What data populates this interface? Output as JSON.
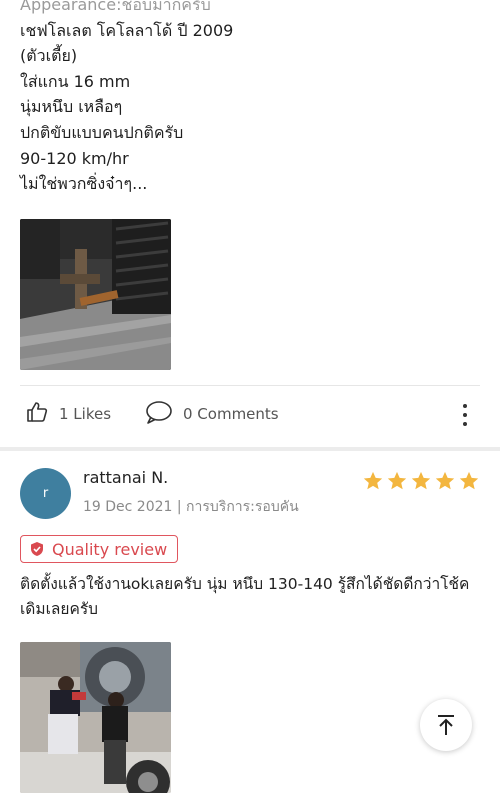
{
  "previous_review": {
    "text_lines": [
      "Appearance:ชอบมากครับ",
      "เชฟโลเลต โคโลลาโด้ ปี 2009",
      "(ตัวเตี้ย)",
      "ใส่แกน 16 mm",
      "นุ่มหนึบ เหลือๆ",
      "ปกติขับแบบคนปกติครับ",
      "90-120 km/hr",
      "ไม่ใช่พวกซิ่งจ๋าๆ..."
    ],
    "likes_label": "1 Likes",
    "comments_label": "0 Comments"
  },
  "review": {
    "avatar_letter": "r",
    "reviewer_name": "rattanai N.",
    "date_service": "19 Dec 2021 | การบริการ:รอบคัน",
    "rating": 5,
    "badge_label": "Quality review",
    "comment": "ติดตั้งแล้วใช้งานokเลยครับ นุ่ม หนึบ 130-140 รู้สึกได้ชัดดีกว่าโช้คเดิมเลยครับ"
  },
  "colors": {
    "star": "#f3b63f",
    "badge": "#d9494f",
    "avatar": "#3f7f9f"
  },
  "icons": {
    "like": "thumbs-up-icon",
    "comment": "speech-bubble-icon",
    "more": "kebab-menu-icon",
    "scroll_top": "arrow-up-to-top-icon",
    "badge": "shield-check-icon"
  }
}
